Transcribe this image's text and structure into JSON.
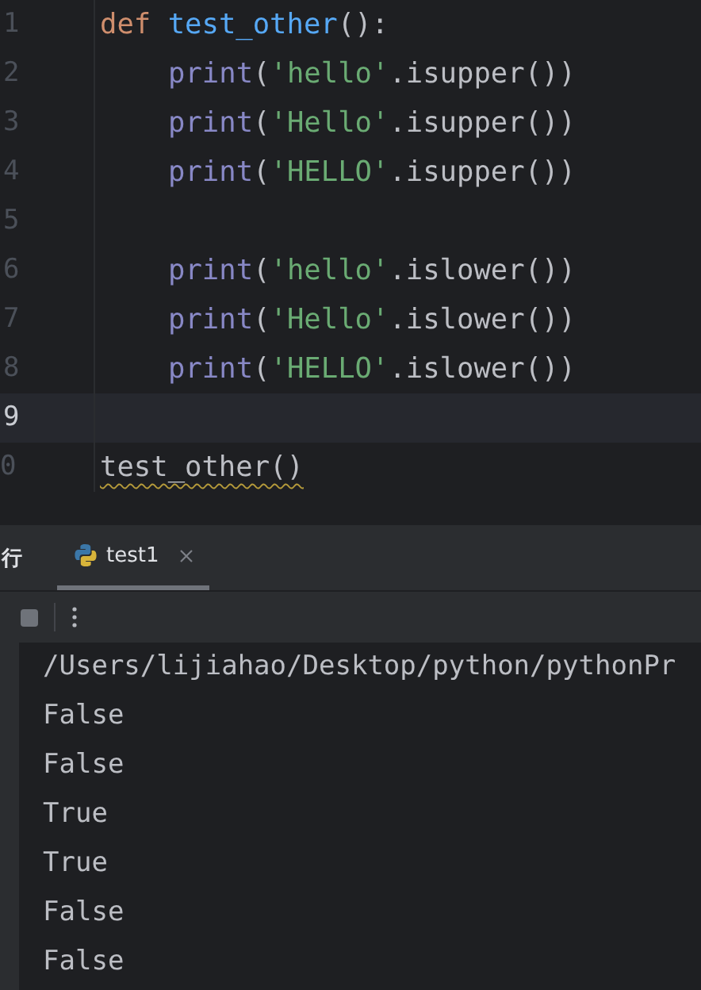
{
  "editor": {
    "lines": [
      {
        "number": "1",
        "current": false,
        "tokens": [
          {
            "text": "def ",
            "kind": "keyword"
          },
          {
            "text": "test_other",
            "kind": "function"
          },
          {
            "text": "():",
            "kind": "plain"
          }
        ],
        "children": [
          {
            "number": "2",
            "current": false,
            "tokens": [
              {
                "text": "print",
                "kind": "builtin"
              },
              {
                "text": "(",
                "kind": "plain"
              },
              {
                "text": "'hello'",
                "kind": "string"
              },
              {
                "text": ".isupper())",
                "kind": "plain"
              }
            ]
          },
          {
            "number": "3",
            "current": false,
            "tokens": [
              {
                "text": "print",
                "kind": "builtin"
              },
              {
                "text": "(",
                "kind": "plain"
              },
              {
                "text": "'Hello'",
                "kind": "string"
              },
              {
                "text": ".isupper())",
                "kind": "plain"
              }
            ]
          },
          {
            "number": "4",
            "current": false,
            "tokens": [
              {
                "text": "print",
                "kind": "builtin"
              },
              {
                "text": "(",
                "kind": "plain"
              },
              {
                "text": "'HELLO'",
                "kind": "string"
              },
              {
                "text": ".isupper())",
                "kind": "plain"
              }
            ]
          },
          {
            "number": "5",
            "current": false
          },
          {
            "number": "6",
            "current": false,
            "tokens": [
              {
                "text": "print",
                "kind": "builtin"
              },
              {
                "text": "(",
                "kind": "plain"
              },
              {
                "text": "'hello'",
                "kind": "string"
              },
              {
                "text": ".islower())",
                "kind": "plain"
              }
            ]
          },
          {
            "number": "7",
            "current": false,
            "tokens": [
              {
                "text": "print",
                "kind": "builtin"
              },
              {
                "text": "(",
                "kind": "plain"
              },
              {
                "text": "'Hello'",
                "kind": "string"
              },
              {
                "text": ".islower())",
                "kind": "plain"
              }
            ]
          },
          {
            "number": "8",
            "current": false,
            "tokens": [
              {
                "text": "print",
                "kind": "builtin"
              },
              {
                "text": "(",
                "kind": "plain"
              },
              {
                "text": "'HELLO'",
                "kind": "string"
              },
              {
                "text": ".islower())",
                "kind": "plain"
              }
            ]
          }
        ]
      },
      {
        "number": "9",
        "current": true
      },
      {
        "number": "0",
        "current": false,
        "tokens": [
          {
            "text": "test_other()",
            "kind": "warning"
          }
        ]
      }
    ]
  },
  "run_panel": {
    "title": "行",
    "tabs": [
      {
        "label": "test1",
        "selected": true
      }
    ],
    "output": [
      "/Users/lijiahao/Desktop/python/pythonPr",
      "False",
      "False",
      "True",
      "True",
      "False",
      "False"
    ]
  }
}
